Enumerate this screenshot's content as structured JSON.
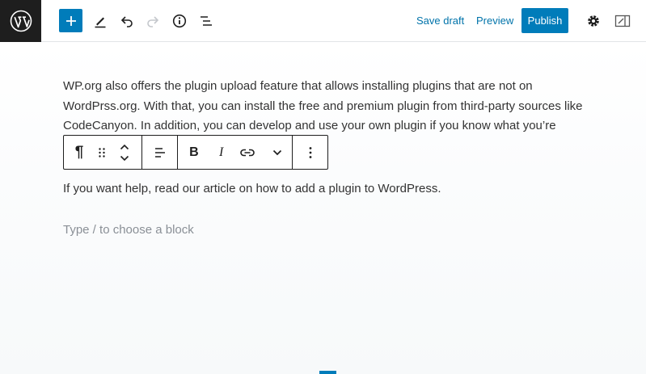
{
  "toolbar": {
    "save_draft_label": "Save draft",
    "preview_label": "Preview",
    "publish_label": "Publish"
  },
  "editor": {
    "paragraph_1": "WP.org also offers the plugin upload feature that allows installing plugins that are not on WordPrss.org. With that, you can install the free and premium plugin from third-party sources like CodeCanyon. In addition, you can develop and use your own plugin if you know what you’re",
    "paragraph_2": "If you want help, read our article on how to add a plugin to WordPress.",
    "placeholder": "Type / to choose a block"
  },
  "block_toolbar": {
    "paragraph_symbol": "¶",
    "bold_label": "B",
    "italic_label": "I"
  },
  "colors": {
    "accent": "#007cba",
    "logo_bg": "#1e1e1e",
    "link": "#0073aa"
  },
  "icons": [
    "wordpress-logo-icon",
    "plus-icon",
    "pencil-icon",
    "undo-icon",
    "redo-icon",
    "info-icon",
    "list-view-icon",
    "gear-icon",
    "sidebar-toggle-icon",
    "drag-handle-icon",
    "move-up-icon",
    "move-down-icon",
    "align-left-icon",
    "link-icon",
    "chevron-down-icon",
    "more-options-icon"
  ]
}
